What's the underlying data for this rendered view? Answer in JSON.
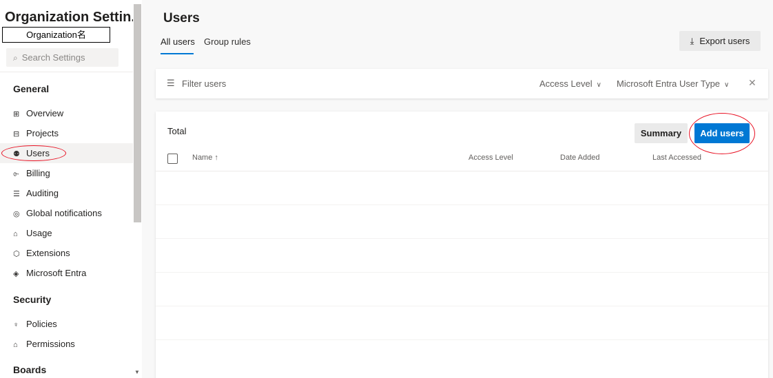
{
  "sidebar": {
    "org_title": "Organization Settin...",
    "org_name_label": "Organization名",
    "search_placeholder": "Search Settings",
    "sections": {
      "general": "General",
      "security": "Security",
      "boards": "Boards"
    },
    "items": [
      {
        "label": "Overview",
        "icon": "overview-icon"
      },
      {
        "label": "Projects",
        "icon": "projects-icon"
      },
      {
        "label": "Users",
        "icon": "users-icon",
        "selected": true
      },
      {
        "label": "Billing",
        "icon": "billing-icon"
      },
      {
        "label": "Auditing",
        "icon": "auditing-icon"
      },
      {
        "label": "Global notifications",
        "icon": "notifications-icon"
      },
      {
        "label": "Usage",
        "icon": "usage-icon"
      },
      {
        "label": "Extensions",
        "icon": "extensions-icon"
      },
      {
        "label": "Microsoft Entra",
        "icon": "entra-icon"
      },
      {
        "label": "Policies",
        "icon": "policies-icon"
      },
      {
        "label": "Permissions",
        "icon": "permissions-icon"
      }
    ]
  },
  "main": {
    "title": "Users",
    "tabs": [
      {
        "label": "All users",
        "active": true
      },
      {
        "label": "Group rules",
        "active": false
      }
    ],
    "export_label": "Export users",
    "filter": {
      "placeholder": "Filter users",
      "access_level": "Access Level",
      "entra_type": "Microsoft Entra User Type"
    },
    "table": {
      "total_label": "Total",
      "summary_label": "Summary",
      "add_label": "Add users",
      "columns": [
        "Name ↑",
        "Access Level",
        "Date Added",
        "Last Accessed"
      ]
    }
  },
  "colors": {
    "accent": "#0078d4",
    "annotation": "#e81123"
  }
}
